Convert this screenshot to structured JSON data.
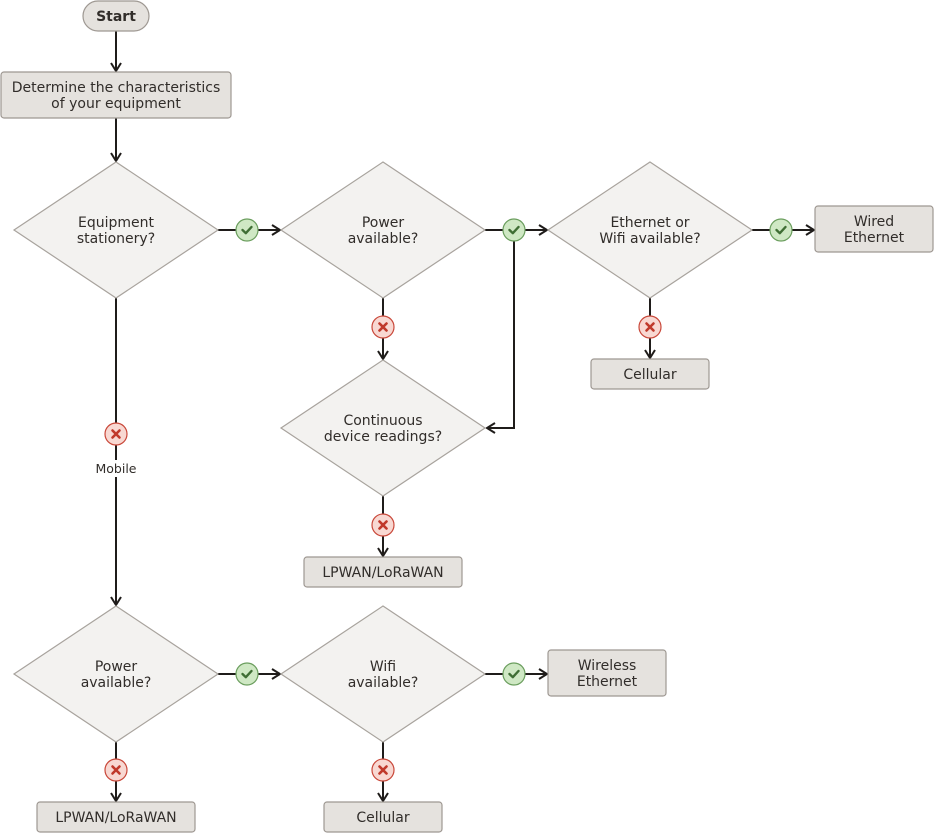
{
  "diagram": {
    "colors": {
      "node_fill": "#e5e2de",
      "node_stroke": "#9e9892",
      "decision_fill": "#f3f2f0",
      "decision_stroke": "#a8a39d",
      "line": "#1f1c1a",
      "yes_fill": "#cfe8c4",
      "yes_stroke": "#6b9e5e",
      "yes_mark": "#3f6e34",
      "no_fill": "#f8d8d2",
      "no_stroke": "#c9483a",
      "no_mark": "#c0392b",
      "text": "#312d2a"
    },
    "nodes": {
      "start": {
        "type": "terminal",
        "lines": [
          "Start"
        ]
      },
      "determine": {
        "type": "process",
        "lines": [
          "Determine the characteristics",
          "of your equipment"
        ]
      },
      "stationary": {
        "type": "decision",
        "lines": [
          "Equipment",
          "stationery?"
        ]
      },
      "power1": {
        "type": "decision",
        "lines": [
          "Power",
          "available?"
        ]
      },
      "ethwifi": {
        "type": "decision",
        "lines": [
          "Ethernet or",
          "Wifi available?"
        ]
      },
      "wired": {
        "type": "process",
        "lines": [
          "Wired",
          "Ethernet"
        ]
      },
      "cellular1": {
        "type": "process",
        "lines": [
          "Cellular"
        ]
      },
      "continuous": {
        "type": "decision",
        "lines": [
          "Continuous",
          "device readings?"
        ]
      },
      "lpwan1": {
        "type": "process",
        "lines": [
          "LPWAN/LoRaWAN"
        ]
      },
      "power2": {
        "type": "decision",
        "lines": [
          "Power",
          "available?"
        ]
      },
      "wifi": {
        "type": "decision",
        "lines": [
          "Wifi",
          "available?"
        ]
      },
      "wireless": {
        "type": "process",
        "lines": [
          "Wireless",
          "Ethernet"
        ]
      },
      "lpwan2": {
        "type": "process",
        "lines": [
          "LPWAN/LoRaWAN"
        ]
      },
      "cellular2": {
        "type": "process",
        "lines": [
          "Cellular"
        ]
      }
    },
    "edges": [
      {
        "from": "start",
        "to": "determine",
        "condition": "none"
      },
      {
        "from": "determine",
        "to": "stationary",
        "condition": "none"
      },
      {
        "from": "stationary",
        "to": "power1",
        "condition": "yes"
      },
      {
        "from": "power1",
        "to": "ethwifi",
        "condition": "yes"
      },
      {
        "from": "power1",
        "to": "continuous",
        "condition": "yes",
        "note": "branch from yes"
      },
      {
        "from": "ethwifi",
        "to": "wired",
        "condition": "yes"
      },
      {
        "from": "ethwifi",
        "to": "cellular1",
        "condition": "no"
      },
      {
        "from": "power1",
        "to": "continuous",
        "condition": "no"
      },
      {
        "from": "continuous",
        "to": "lpwan1",
        "condition": "no"
      },
      {
        "from": "stationary",
        "to": "power2",
        "condition": "no",
        "label": "Mobile"
      },
      {
        "from": "power2",
        "to": "wifi",
        "condition": "yes"
      },
      {
        "from": "wifi",
        "to": "wireless",
        "condition": "yes"
      },
      {
        "from": "power2",
        "to": "lpwan2",
        "condition": "no"
      },
      {
        "from": "wifi",
        "to": "cellular2",
        "condition": "no"
      }
    ]
  }
}
